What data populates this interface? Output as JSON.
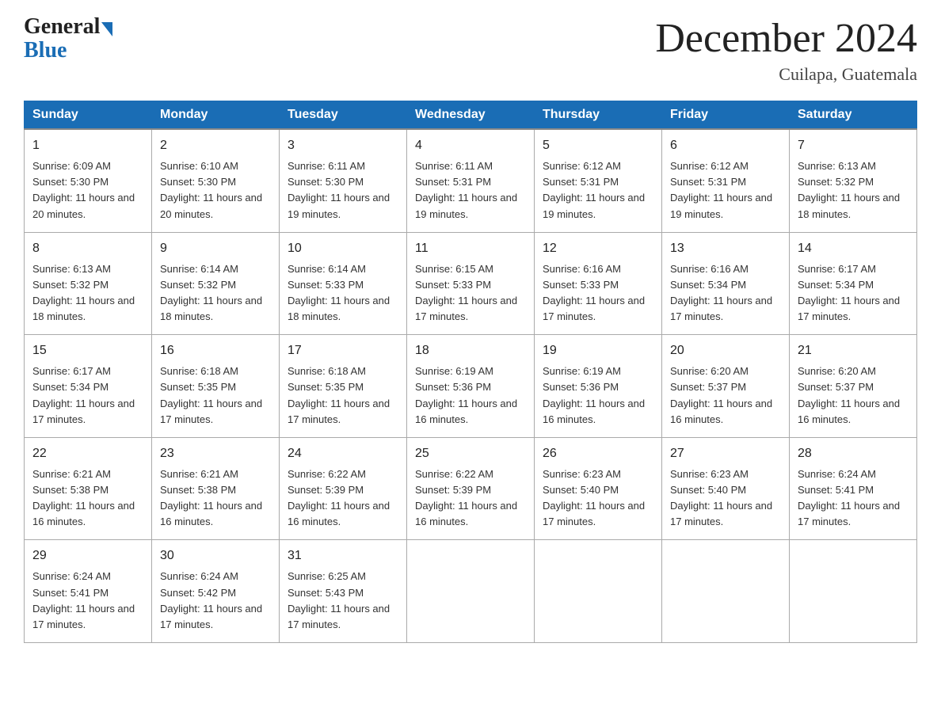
{
  "header": {
    "logo_general": "General",
    "logo_blue": "Blue",
    "month_title": "December 2024",
    "location": "Cuilapa, Guatemala"
  },
  "columns": [
    "Sunday",
    "Monday",
    "Tuesday",
    "Wednesday",
    "Thursday",
    "Friday",
    "Saturday"
  ],
  "weeks": [
    [
      {
        "day": "1",
        "sunrise": "Sunrise: 6:09 AM",
        "sunset": "Sunset: 5:30 PM",
        "daylight": "Daylight: 11 hours and 20 minutes."
      },
      {
        "day": "2",
        "sunrise": "Sunrise: 6:10 AM",
        "sunset": "Sunset: 5:30 PM",
        "daylight": "Daylight: 11 hours and 20 minutes."
      },
      {
        "day": "3",
        "sunrise": "Sunrise: 6:11 AM",
        "sunset": "Sunset: 5:30 PM",
        "daylight": "Daylight: 11 hours and 19 minutes."
      },
      {
        "day": "4",
        "sunrise": "Sunrise: 6:11 AM",
        "sunset": "Sunset: 5:31 PM",
        "daylight": "Daylight: 11 hours and 19 minutes."
      },
      {
        "day": "5",
        "sunrise": "Sunrise: 6:12 AM",
        "sunset": "Sunset: 5:31 PM",
        "daylight": "Daylight: 11 hours and 19 minutes."
      },
      {
        "day": "6",
        "sunrise": "Sunrise: 6:12 AM",
        "sunset": "Sunset: 5:31 PM",
        "daylight": "Daylight: 11 hours and 19 minutes."
      },
      {
        "day": "7",
        "sunrise": "Sunrise: 6:13 AM",
        "sunset": "Sunset: 5:32 PM",
        "daylight": "Daylight: 11 hours and 18 minutes."
      }
    ],
    [
      {
        "day": "8",
        "sunrise": "Sunrise: 6:13 AM",
        "sunset": "Sunset: 5:32 PM",
        "daylight": "Daylight: 11 hours and 18 minutes."
      },
      {
        "day": "9",
        "sunrise": "Sunrise: 6:14 AM",
        "sunset": "Sunset: 5:32 PM",
        "daylight": "Daylight: 11 hours and 18 minutes."
      },
      {
        "day": "10",
        "sunrise": "Sunrise: 6:14 AM",
        "sunset": "Sunset: 5:33 PM",
        "daylight": "Daylight: 11 hours and 18 minutes."
      },
      {
        "day": "11",
        "sunrise": "Sunrise: 6:15 AM",
        "sunset": "Sunset: 5:33 PM",
        "daylight": "Daylight: 11 hours and 17 minutes."
      },
      {
        "day": "12",
        "sunrise": "Sunrise: 6:16 AM",
        "sunset": "Sunset: 5:33 PM",
        "daylight": "Daylight: 11 hours and 17 minutes."
      },
      {
        "day": "13",
        "sunrise": "Sunrise: 6:16 AM",
        "sunset": "Sunset: 5:34 PM",
        "daylight": "Daylight: 11 hours and 17 minutes."
      },
      {
        "day": "14",
        "sunrise": "Sunrise: 6:17 AM",
        "sunset": "Sunset: 5:34 PM",
        "daylight": "Daylight: 11 hours and 17 minutes."
      }
    ],
    [
      {
        "day": "15",
        "sunrise": "Sunrise: 6:17 AM",
        "sunset": "Sunset: 5:34 PM",
        "daylight": "Daylight: 11 hours and 17 minutes."
      },
      {
        "day": "16",
        "sunrise": "Sunrise: 6:18 AM",
        "sunset": "Sunset: 5:35 PM",
        "daylight": "Daylight: 11 hours and 17 minutes."
      },
      {
        "day": "17",
        "sunrise": "Sunrise: 6:18 AM",
        "sunset": "Sunset: 5:35 PM",
        "daylight": "Daylight: 11 hours and 17 minutes."
      },
      {
        "day": "18",
        "sunrise": "Sunrise: 6:19 AM",
        "sunset": "Sunset: 5:36 PM",
        "daylight": "Daylight: 11 hours and 16 minutes."
      },
      {
        "day": "19",
        "sunrise": "Sunrise: 6:19 AM",
        "sunset": "Sunset: 5:36 PM",
        "daylight": "Daylight: 11 hours and 16 minutes."
      },
      {
        "day": "20",
        "sunrise": "Sunrise: 6:20 AM",
        "sunset": "Sunset: 5:37 PM",
        "daylight": "Daylight: 11 hours and 16 minutes."
      },
      {
        "day": "21",
        "sunrise": "Sunrise: 6:20 AM",
        "sunset": "Sunset: 5:37 PM",
        "daylight": "Daylight: 11 hours and 16 minutes."
      }
    ],
    [
      {
        "day": "22",
        "sunrise": "Sunrise: 6:21 AM",
        "sunset": "Sunset: 5:38 PM",
        "daylight": "Daylight: 11 hours and 16 minutes."
      },
      {
        "day": "23",
        "sunrise": "Sunrise: 6:21 AM",
        "sunset": "Sunset: 5:38 PM",
        "daylight": "Daylight: 11 hours and 16 minutes."
      },
      {
        "day": "24",
        "sunrise": "Sunrise: 6:22 AM",
        "sunset": "Sunset: 5:39 PM",
        "daylight": "Daylight: 11 hours and 16 minutes."
      },
      {
        "day": "25",
        "sunrise": "Sunrise: 6:22 AM",
        "sunset": "Sunset: 5:39 PM",
        "daylight": "Daylight: 11 hours and 16 minutes."
      },
      {
        "day": "26",
        "sunrise": "Sunrise: 6:23 AM",
        "sunset": "Sunset: 5:40 PM",
        "daylight": "Daylight: 11 hours and 17 minutes."
      },
      {
        "day": "27",
        "sunrise": "Sunrise: 6:23 AM",
        "sunset": "Sunset: 5:40 PM",
        "daylight": "Daylight: 11 hours and 17 minutes."
      },
      {
        "day": "28",
        "sunrise": "Sunrise: 6:24 AM",
        "sunset": "Sunset: 5:41 PM",
        "daylight": "Daylight: 11 hours and 17 minutes."
      }
    ],
    [
      {
        "day": "29",
        "sunrise": "Sunrise: 6:24 AM",
        "sunset": "Sunset: 5:41 PM",
        "daylight": "Daylight: 11 hours and 17 minutes."
      },
      {
        "day": "30",
        "sunrise": "Sunrise: 6:24 AM",
        "sunset": "Sunset: 5:42 PM",
        "daylight": "Daylight: 11 hours and 17 minutes."
      },
      {
        "day": "31",
        "sunrise": "Sunrise: 6:25 AM",
        "sunset": "Sunset: 5:43 PM",
        "daylight": "Daylight: 11 hours and 17 minutes."
      },
      null,
      null,
      null,
      null
    ]
  ]
}
